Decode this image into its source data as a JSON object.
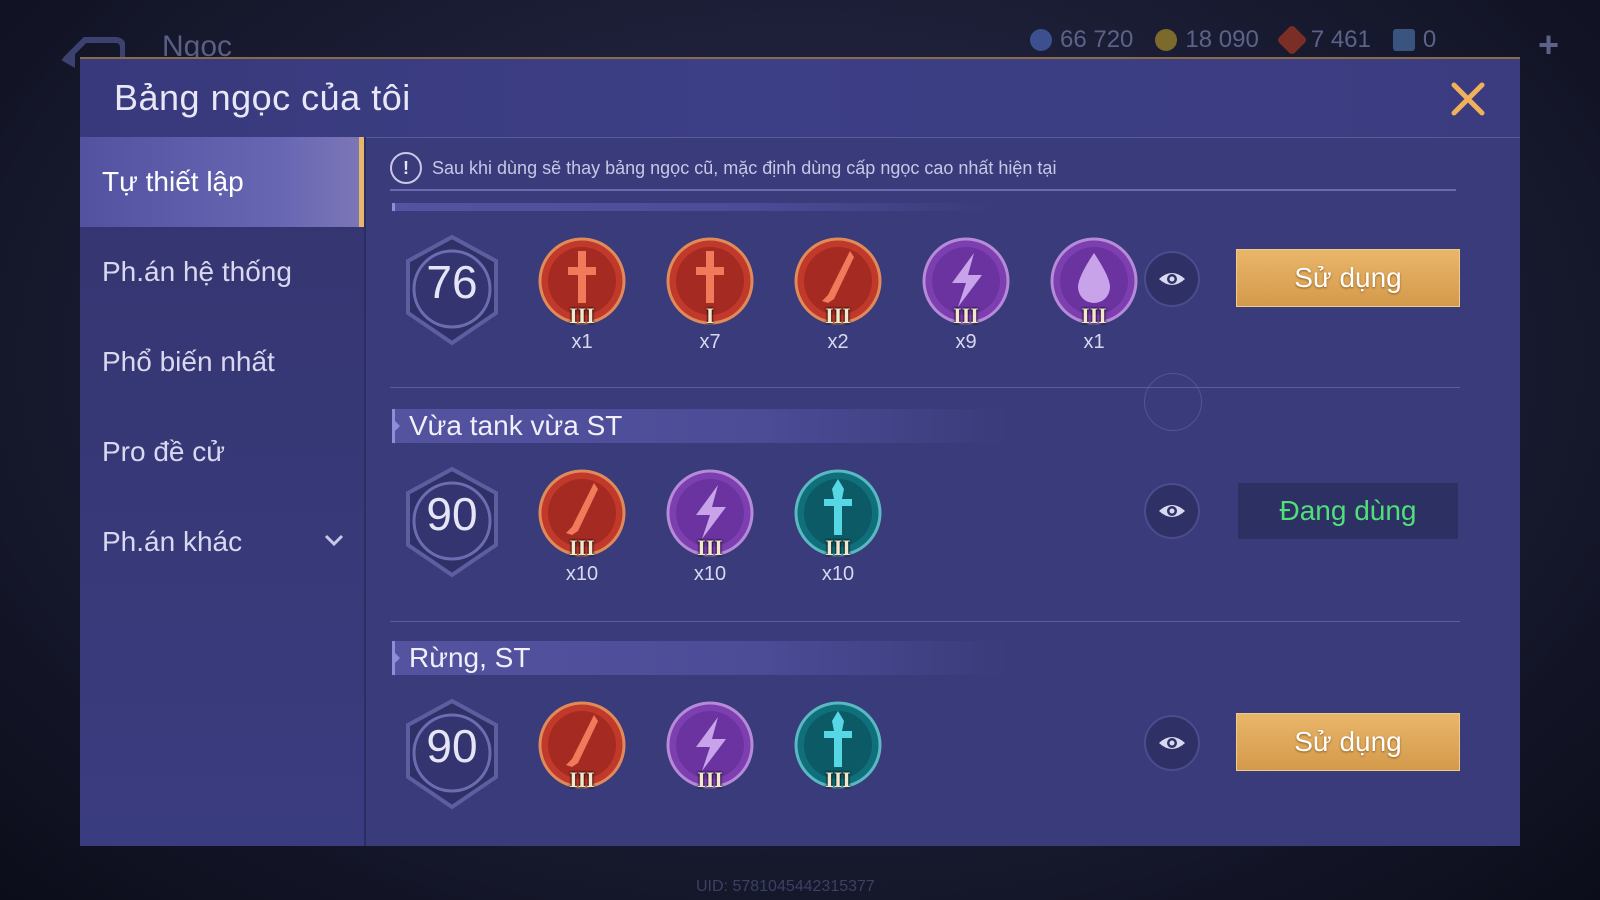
{
  "background": {
    "title": "Ngọc",
    "currencies": [
      {
        "icon": "gem-currency-icon",
        "value": "66 720",
        "color": "#5a6fb0"
      },
      {
        "icon": "gold-coin-icon",
        "value": "18 090",
        "color": "#c9a33a"
      },
      {
        "icon": "ruby-currency-icon",
        "value": "7 461",
        "color": "#b8432f"
      },
      {
        "icon": "ticket-icon",
        "value": "0",
        "color": "#6a8fc8"
      }
    ],
    "uid": "UID: 5781045442315377"
  },
  "modal": {
    "title": "Bảng ngọc của tôi",
    "notice": "Sau khi dùng sẽ thay bảng ngọc cũ, mặc định dùng cấp ngọc cao nhất hiện tại",
    "notice_icon": "!"
  },
  "sidebar": {
    "items": [
      {
        "label": "Tự thiết lập",
        "active": true
      },
      {
        "label": "Ph.án hệ thống",
        "active": false
      },
      {
        "label": "Phổ biến nhất",
        "active": false
      },
      {
        "label": "Pro đề cử",
        "active": false
      },
      {
        "label": "Ph.án khác",
        "active": false,
        "has_dropdown": true
      }
    ]
  },
  "builds": [
    {
      "name": "",
      "level": "76",
      "gems": [
        {
          "type": "red-sword",
          "tier": "III",
          "count": "x1"
        },
        {
          "type": "red-sword",
          "tier": "I",
          "count": "x7"
        },
        {
          "type": "red-blade",
          "tier": "III",
          "count": "x2"
        },
        {
          "type": "purple-lightning",
          "tier": "III",
          "count": "x9"
        },
        {
          "type": "purple-drop",
          "tier": "III",
          "count": "x1"
        }
      ],
      "action": "Sử dụng",
      "in_use": false
    },
    {
      "name": "Vừa tank vừa ST",
      "level": "90",
      "gems": [
        {
          "type": "red-blade",
          "tier": "III",
          "count": "x10"
        },
        {
          "type": "purple-lightning",
          "tier": "III",
          "count": "x10"
        },
        {
          "type": "teal-sword",
          "tier": "III",
          "count": "x10"
        }
      ],
      "action": "Đang dùng",
      "in_use": true
    },
    {
      "name": "Rừng, ST",
      "level": "90",
      "gems": [
        {
          "type": "red-blade",
          "tier": "III",
          "count": ""
        },
        {
          "type": "purple-lightning",
          "tier": "III",
          "count": ""
        },
        {
          "type": "teal-sword",
          "tier": "III",
          "count": ""
        }
      ],
      "action": "Sử dụng",
      "in_use": false
    }
  ],
  "colors": {
    "accent_gold": "#e8b66a",
    "in_use_green": "#4fe07a",
    "panel": "#3a3b7a"
  }
}
